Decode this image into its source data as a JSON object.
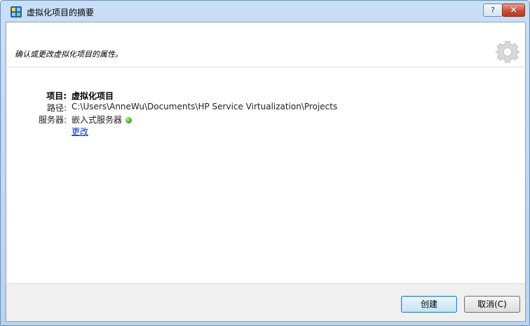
{
  "window": {
    "title": "虚拟化项目的摘要",
    "help_label": "?",
    "close_label": "✕"
  },
  "header": {
    "description": "确认或更改虚拟化项目的属性。",
    "icon": "gear-icon"
  },
  "info": {
    "project_label": "项目:",
    "project_value": "虚拟化项目",
    "path_label": "路径:",
    "path_value": "C:\\Users\\AnneWu\\Documents\\HP Service Virtualization\\Projects",
    "server_label": "服务器:",
    "server_value": "嵌入式服务器",
    "server_status_color": "#3fae1e",
    "change_link": "更改"
  },
  "footer": {
    "create_label": "创建",
    "cancel_label": "取消(C)"
  }
}
